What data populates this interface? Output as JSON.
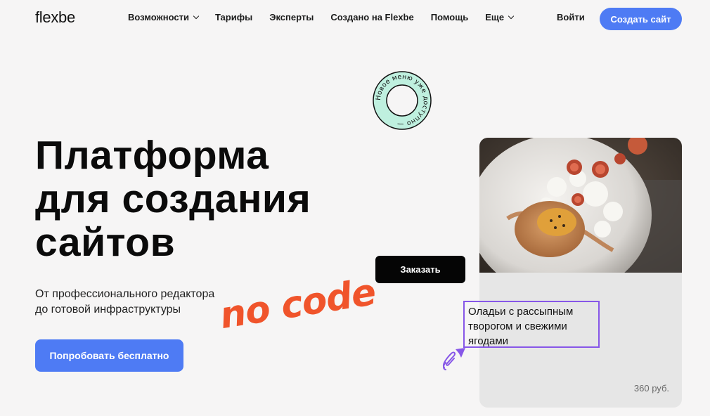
{
  "header": {
    "logo": "flexbe",
    "nav": [
      {
        "label": "Возможности",
        "has_dropdown": true
      },
      {
        "label": "Тарифы",
        "has_dropdown": false
      },
      {
        "label": "Эксперты",
        "has_dropdown": false
      },
      {
        "label": "Создано на Flexbe",
        "has_dropdown": false
      },
      {
        "label": "Помощь",
        "has_dropdown": false
      },
      {
        "label": "Еще",
        "has_dropdown": true
      }
    ],
    "login_label": "Войти",
    "create_site_label": "Создать сайт"
  },
  "hero": {
    "title_lines": [
      "Платформа",
      "для создания",
      "сайтов"
    ],
    "subtitle_lines": [
      "От профессионального редактора",
      "до готовой инфраструктуры"
    ],
    "cta_label": "Попробовать бесплатно"
  },
  "badge": {
    "text": "Новое меню уже доступно —"
  },
  "decor": {
    "nocode_text": "no code"
  },
  "product": {
    "order_label": "Заказать",
    "name_lines": [
      "Оладьи с рассыпным",
      "творогом и свежими",
      "ягодами"
    ],
    "price": "360 руб."
  },
  "colors": {
    "accent": "#4e7bf4",
    "nocode": "#f0542b",
    "selection": "#8757e8",
    "badge_ring": "#bff0df"
  }
}
